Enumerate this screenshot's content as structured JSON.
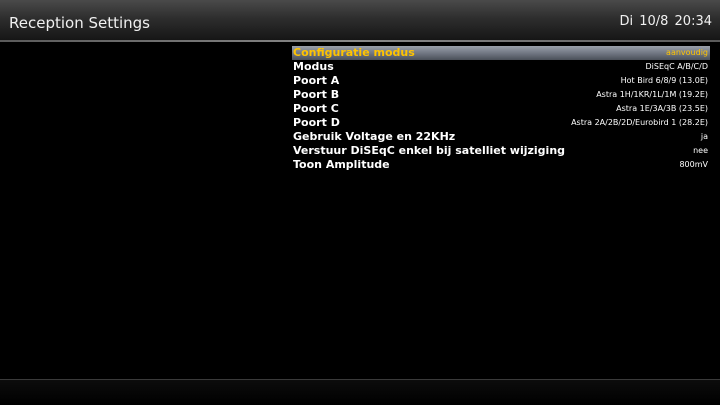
{
  "header": {
    "title": "Reception Settings",
    "clock": "Di 10/8  20:34"
  },
  "menu": {
    "selected_index": 0,
    "items": [
      {
        "label": "Configuratie modus",
        "value": "aanvoudig"
      },
      {
        "label": "Modus",
        "value": "DiSEqC A/B/C/D"
      },
      {
        "label": "Poort A",
        "value": "Hot Bird 6/8/9 (13.0E)"
      },
      {
        "label": "Poort B",
        "value": "Astra 1H/1KR/1L/1M (19.2E)"
      },
      {
        "label": "Poort C",
        "value": "Astra 1E/3A/3B (23.5E)"
      },
      {
        "label": "Poort D",
        "value": "Astra 2A/2B/2D/Eurobird 1 (28.2E)"
      },
      {
        "label": "Gebruik Voltage en 22KHz",
        "value": "ja"
      },
      {
        "label": "Verstuur DiSEqC enkel bij satelliet wijziging",
        "value": "nee"
      },
      {
        "label": "Toon Amplitude",
        "value": "800mV"
      }
    ]
  },
  "colors": {
    "background": "#000000",
    "text": "#ffffff",
    "selected_text": "#ffc400",
    "selected_bar": "#7a808a"
  }
}
